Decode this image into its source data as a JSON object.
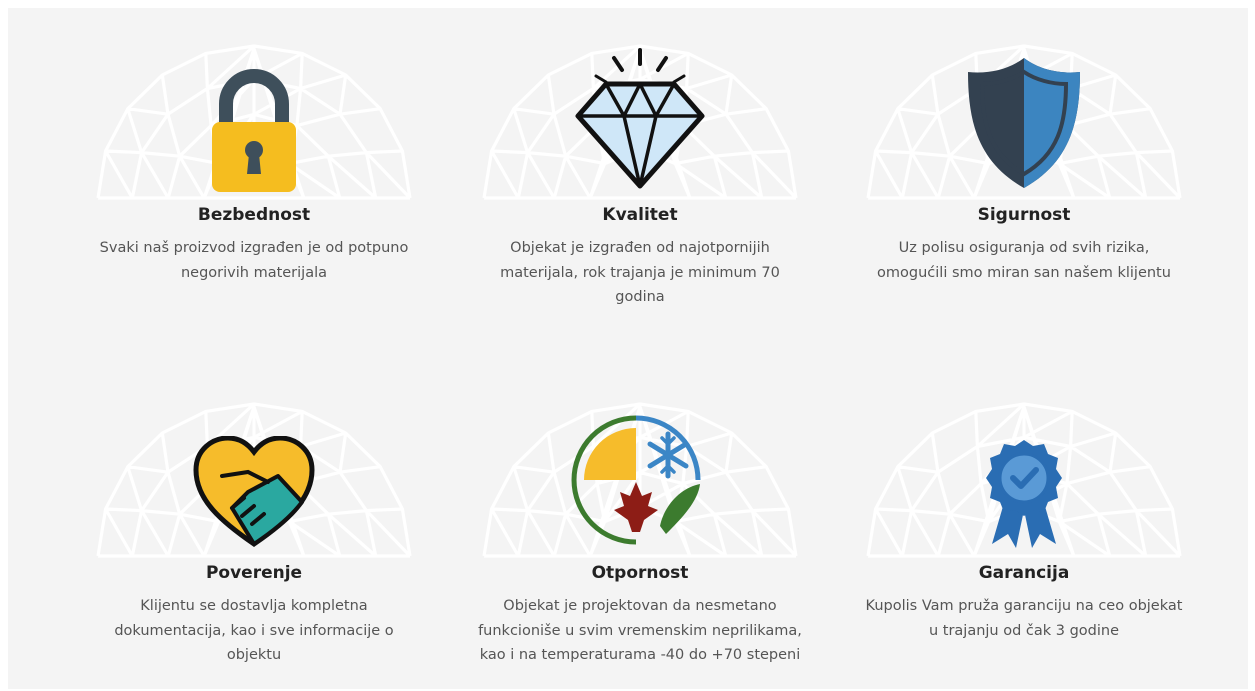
{
  "features": [
    {
      "key": "bezbednost",
      "title": "Bezbednost",
      "icon": "padlock-icon",
      "desc": "Svaki naš proizvod izgrađen je od potpuno negorivih materijala"
    },
    {
      "key": "kvalitet",
      "title": "Kvalitet",
      "icon": "diamond-icon",
      "desc": "Objekat je izgrađen od najotpornijih materijala, rok trajanja je minimum 70 godina"
    },
    {
      "key": "sigurnost",
      "title": "Sigurnost",
      "icon": "shield-icon",
      "desc": "Uz polisu osiguranja od svih rizika, omogućili smo miran san našem klijentu"
    },
    {
      "key": "poverenje",
      "title": "Poverenje",
      "icon": "handshake-heart-icon",
      "desc": "Klijentu se dostavlja kompletna dokumentacija, kao i sve informacije o objektu"
    },
    {
      "key": "otpornost",
      "title": "Otpornost",
      "icon": "seasons-icon",
      "desc": "Objekat je projektovan da nesmetano funkcioniše u svim vremenskim neprilikama, kao i na temperaturama -40 do +70 stepeni"
    },
    {
      "key": "garancija",
      "title": "Garancija",
      "icon": "award-badge-icon",
      "desc": "Kupolis Vam pruža garanciju na ceo objekat u trajanju od čak 3 godine"
    }
  ],
  "colors": {
    "background": "#f4f4f4",
    "dome_lines": "#ffffff",
    "title": "#222222",
    "text": "#555555",
    "lock_body": "#f5bd1f",
    "lock_shackle": "#3e4f5b",
    "diamond_fill": "#cfe7f8",
    "shield_dark": "#334150",
    "shield_blue": "#3c85c0",
    "heart_yellow": "#f6bc2b",
    "heart_teal": "#2aa8a0",
    "snow_blue": "#3b86c6",
    "leaf_red": "#8d1d16",
    "leaf_green": "#3c7b2e",
    "badge_blue": "#2a6db3"
  }
}
